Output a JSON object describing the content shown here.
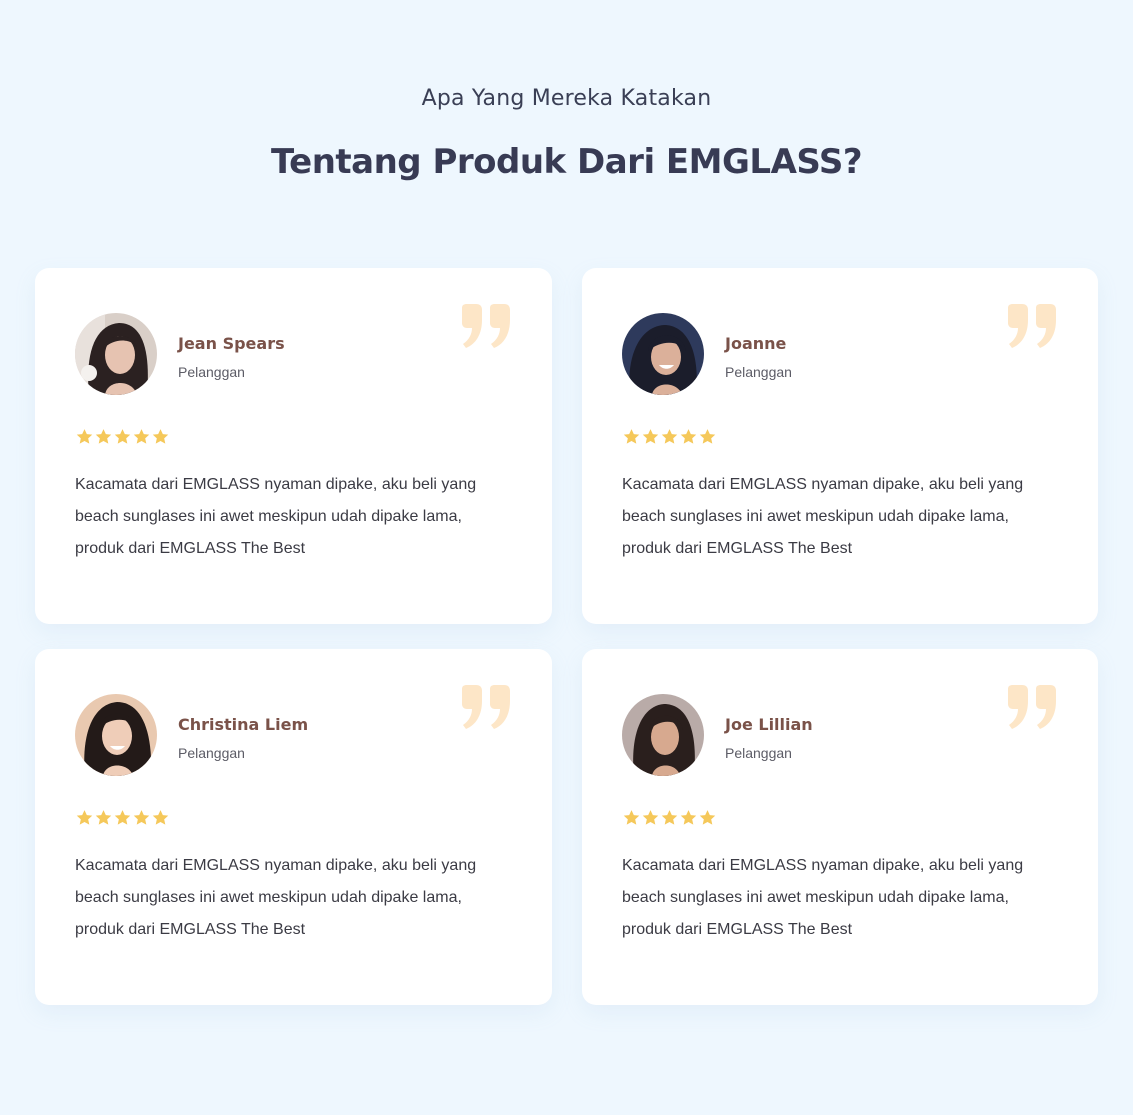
{
  "header": {
    "subtitle": "Apa Yang Mereka Katakan",
    "title": "Tentang Produk Dari EMGLASS?"
  },
  "colors": {
    "background": "#eef7fe",
    "card": "#ffffff",
    "name": "#7a5249",
    "star": "#f5c85a",
    "quote_mark": "#fde6c7"
  },
  "testimonials": [
    {
      "name": "Jean Spears",
      "role": "Pelanggan",
      "rating": 5,
      "text": "Kacamata dari EMGLASS nyaman dipake, aku beli yang beach sunglases ini awet meskipun udah dipake lama, produk dari EMGLASS The Best"
    },
    {
      "name": "Joanne",
      "role": "Pelanggan",
      "rating": 5,
      "text": "Kacamata dari EMGLASS nyaman dipake, aku beli yang beach sunglases ini awet meskipun udah dipake lama, produk dari EMGLASS The Best"
    },
    {
      "name": "Christina Liem",
      "role": "Pelanggan",
      "rating": 5,
      "text": "Kacamata dari EMGLASS nyaman dipake, aku beli yang beach sunglases ini awet meskipun udah dipake lama, produk dari EMGLASS The Best"
    },
    {
      "name": "Joe Lillian",
      "role": "Pelanggan",
      "rating": 5,
      "text": "Kacamata dari EMGLASS nyaman dipake, aku beli yang beach sunglases ini awet meskipun udah dipake lama, produk dari EMGLASS The Best"
    }
  ],
  "icons": {
    "quote": "quote-icon",
    "star": "star-icon",
    "avatar": "avatar"
  }
}
